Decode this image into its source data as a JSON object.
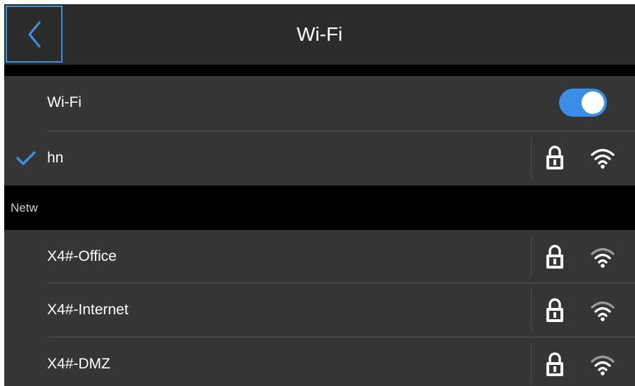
{
  "header": {
    "title": "Wi-Fi",
    "back_icon": "chevron-left-icon"
  },
  "wifi_toggle": {
    "label": "Wi-Fi",
    "on": true,
    "accent_color": "#3b8de6"
  },
  "connected_network": {
    "name": "hn",
    "connected_icon": "checkmark-icon",
    "secured": true,
    "signal": "full"
  },
  "available_section": {
    "label": "Netw"
  },
  "networks": [
    {
      "name": "X4#-Office",
      "secured": true,
      "signal": "medium"
    },
    {
      "name": "X4#-Internet",
      "secured": true,
      "signal": "medium"
    },
    {
      "name": "X4#-DMZ",
      "secured": true,
      "signal": "medium"
    }
  ]
}
